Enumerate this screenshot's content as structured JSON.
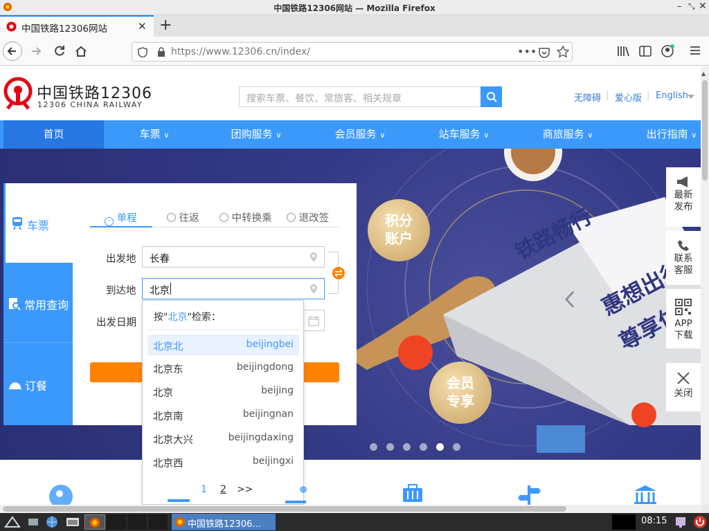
{
  "window": {
    "title": "中国铁路12306网站 — Mozilla Firefox"
  },
  "browser": {
    "tab_title": "中国铁路12306网站",
    "url": "https://www.12306.cn/index/"
  },
  "site": {
    "logo_cn": "中国铁路12306",
    "logo_en": "12306 CHINA RAILWAY",
    "search_placeholder": "搜索车票、餐饮、常旅客、相关规章",
    "toplinks": {
      "accessible": "无障碍",
      "care": "爱心版",
      "english": "English"
    },
    "nav": [
      "首页",
      "车票",
      "团购服务",
      "会员服务",
      "站车服务",
      "商旅服务",
      "出行指南"
    ],
    "sidenav": [
      "车票",
      "常用查询",
      "订餐"
    ],
    "trip_tabs": [
      "单程",
      "往返",
      "中转换乘",
      "退改签"
    ],
    "form": {
      "from_label": "出发地",
      "from_value": "长春",
      "to_label": "到达地",
      "to_value": "北京",
      "date_label": "出发日期"
    },
    "dropdown": {
      "hint_prefix": "按\"",
      "hint_key": "北京",
      "hint_suffix": "\"检索：",
      "items": [
        {
          "cn": "北京北",
          "py": "beijingbei"
        },
        {
          "cn": "北京东",
          "py": "beijingdong"
        },
        {
          "cn": "北京",
          "py": "beijing"
        },
        {
          "cn": "北京南",
          "py": "beijingnan"
        },
        {
          "cn": "北京大兴",
          "py": "beijingdaxing"
        },
        {
          "cn": "北京西",
          "py": "beijingxi"
        }
      ],
      "pages": [
        "1",
        "2",
        ">>"
      ]
    },
    "banner": {
      "badge1_line1": "积分",
      "badge1_line2": "账户",
      "badge2_line1": "会员",
      "badge2_line2": "专享",
      "box_text1": "铁路畅行",
      "box_text2": "惠想出行",
      "box_text3": "尊享体验"
    },
    "sidebar": [
      {
        "l1": "最新",
        "l2": "发布"
      },
      {
        "l1": "联系",
        "l2": "客服"
      },
      {
        "l1": "APP",
        "l2": "下载"
      },
      {
        "l1": "关闭",
        "l2": ""
      }
    ]
  },
  "taskbar": {
    "window_label": "中国铁路12306…",
    "clock": "08:15"
  },
  "colors": {
    "brand_blue": "#3b99fc",
    "logo_red": "#e60012",
    "order_orange": "#ff8200"
  }
}
